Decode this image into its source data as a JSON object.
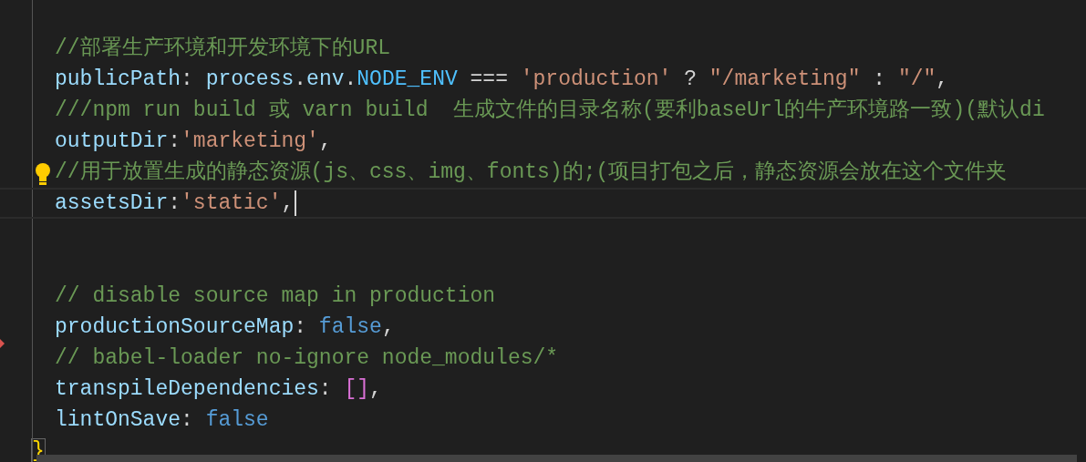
{
  "editor": {
    "lines": [
      {
        "hint": false,
        "current": false,
        "tokens": [
          {
            "kind": "comment",
            "text": "//部署生产环境和开发环境下的URL"
          }
        ]
      },
      {
        "hint": false,
        "current": false,
        "tokens": [
          {
            "kind": "prop",
            "text": "publicPath"
          },
          {
            "kind": "punct",
            "text": ": "
          },
          {
            "kind": "prop",
            "text": "process"
          },
          {
            "kind": "punct",
            "text": "."
          },
          {
            "kind": "prop",
            "text": "env"
          },
          {
            "kind": "punct",
            "text": "."
          },
          {
            "kind": "const",
            "text": "NODE_ENV"
          },
          {
            "kind": "punct",
            "text": " === "
          },
          {
            "kind": "string",
            "text": "'production'"
          },
          {
            "kind": "punct",
            "text": " ? "
          },
          {
            "kind": "string",
            "text": "\"/marketing\""
          },
          {
            "kind": "punct",
            "text": " : "
          },
          {
            "kind": "string",
            "text": "\"/\""
          },
          {
            "kind": "punct",
            "text": ","
          }
        ]
      },
      {
        "hint": false,
        "current": false,
        "tokens": [
          {
            "kind": "comment",
            "text": "///npm run build 或 varn build  生成文件的目录名称(要利baseUrl的牛产环境路一致)(默认di"
          }
        ]
      },
      {
        "hint": false,
        "current": false,
        "tokens": [
          {
            "kind": "prop",
            "text": "outputDir"
          },
          {
            "kind": "punct",
            "text": ":"
          },
          {
            "kind": "string",
            "text": "'marketing'"
          },
          {
            "kind": "punct",
            "text": ","
          }
        ]
      },
      {
        "hint": true,
        "current": false,
        "tokens": [
          {
            "kind": "comment",
            "text": "//用于放置生成的静态资源(js、css、img、fonts)的;(项目打包之后，静态资源会放在这个文件夹"
          }
        ]
      },
      {
        "hint": false,
        "current": true,
        "tokens": [
          {
            "kind": "prop",
            "text": "assetsDir"
          },
          {
            "kind": "punct",
            "text": ":"
          },
          {
            "kind": "string",
            "text": "'static'"
          },
          {
            "kind": "punct",
            "text": ","
          }
        ]
      },
      {
        "hint": false,
        "current": false
      },
      {
        "hint": false,
        "current": false
      },
      {
        "hint": false,
        "current": false,
        "tokens": [
          {
            "kind": "comment",
            "text": "// disable source map in production"
          }
        ]
      },
      {
        "hint": false,
        "current": false,
        "tokens": [
          {
            "kind": "prop",
            "text": "productionSourceMap"
          },
          {
            "kind": "punct",
            "text": ": "
          },
          {
            "kind": "keyword",
            "text": "false"
          },
          {
            "kind": "punct",
            "text": ","
          }
        ]
      },
      {
        "hint": false,
        "current": false,
        "tokens": [
          {
            "kind": "comment",
            "text": "// babel-loader no-ignore node_modules/*"
          }
        ]
      },
      {
        "hint": false,
        "current": false,
        "tokens": [
          {
            "kind": "prop",
            "text": "transpileDependencies"
          },
          {
            "kind": "punct",
            "text": ": "
          },
          {
            "kind": "bracket",
            "text": "[]"
          },
          {
            "kind": "punct",
            "text": ","
          }
        ]
      },
      {
        "hint": false,
        "current": false,
        "tokens": [
          {
            "kind": "prop",
            "text": "lintOnSave"
          },
          {
            "kind": "punct",
            "text": ": "
          },
          {
            "kind": "keyword",
            "text": "false"
          }
        ]
      }
    ],
    "closing": {
      "tokens": [
        {
          "kind": "brace",
          "text": "}"
        }
      ]
    }
  }
}
